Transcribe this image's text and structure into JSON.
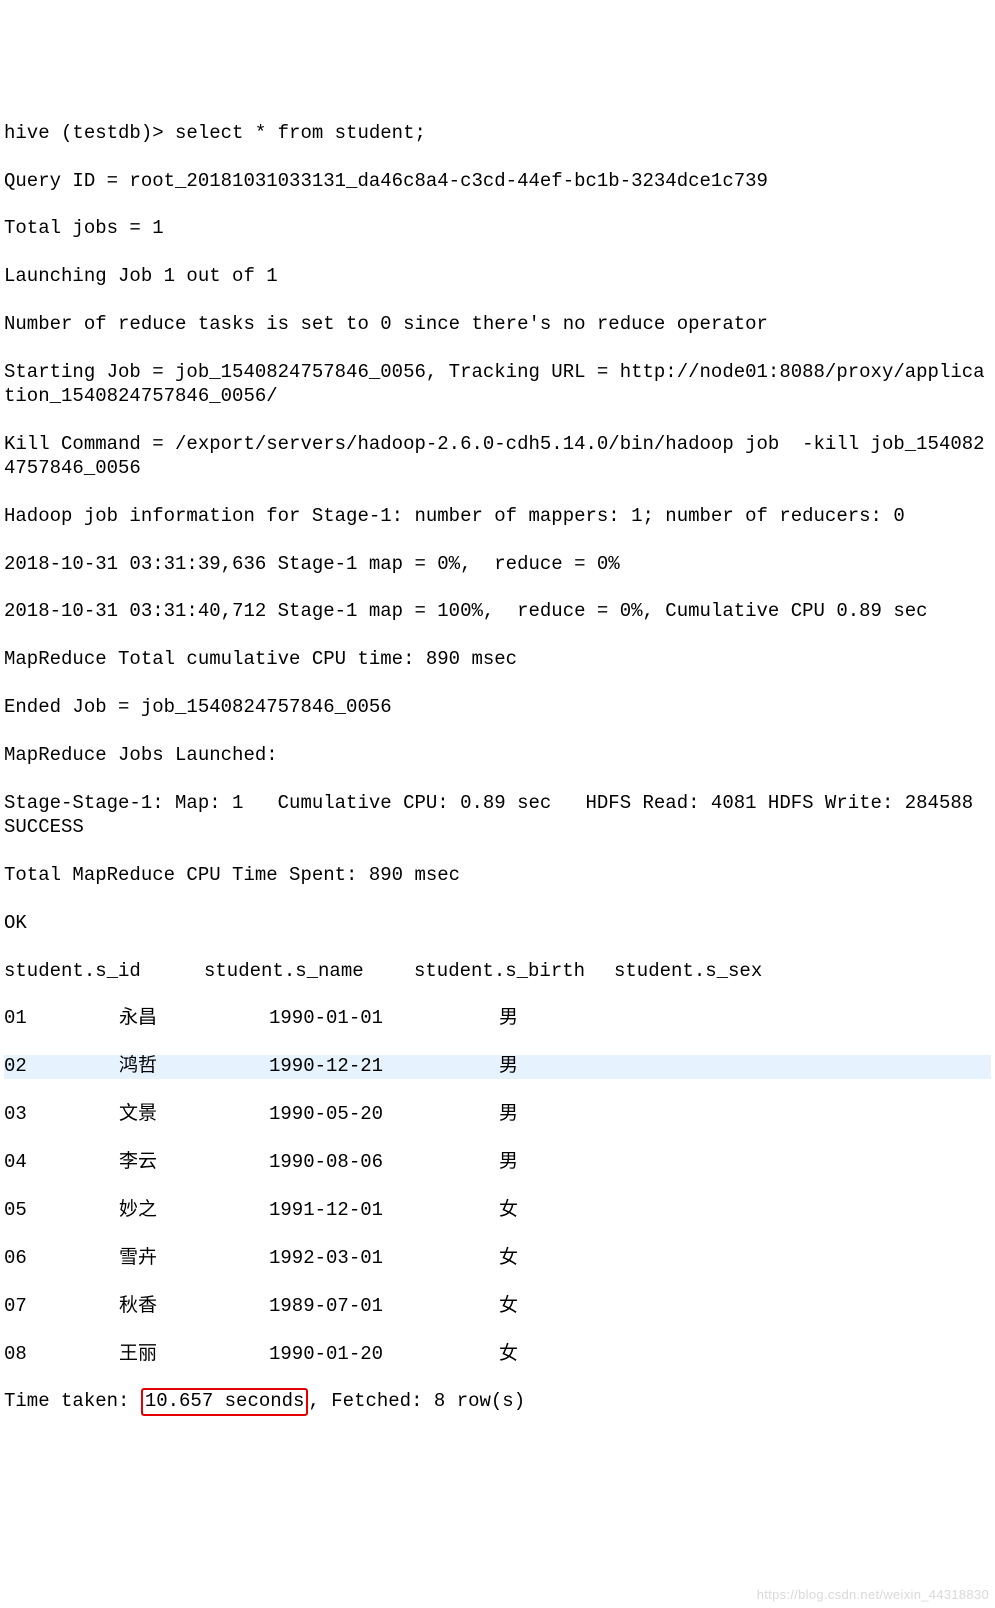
{
  "prompt": "hive (testdb)> ",
  "command": "select * from student;",
  "query_id_line": "Query ID = root_20181031033131_da46c8a4-c3cd-44ef-bc1b-3234dce1c739",
  "total_jobs": "Total jobs = 1",
  "launching": "Launching Job 1 out of 1",
  "reduce_tasks": "Number of reduce tasks is set to 0 since there's no reduce operator",
  "starting_job": "Starting Job = job_1540824757846_0056, Tracking URL = http://node01:8088/proxy/application_1540824757846_0056/",
  "kill_cmd": "Kill Command = /export/servers/hadoop-2.6.0-cdh5.14.0/bin/hadoop job  -kill job_1540824757846_0056",
  "hadoop_info": "Hadoop job information for Stage-1: number of mappers: 1; number of reducers: 0",
  "progress1": "2018-10-31 03:31:39,636 Stage-1 map = 0%,  reduce = 0%",
  "progress2": "2018-10-31 03:31:40,712 Stage-1 map = 100%,  reduce = 0%, Cumulative CPU 0.89 sec",
  "mr_total": "MapReduce Total cumulative CPU time: 890 msec",
  "ended_job": "Ended Job = job_1540824757846_0056",
  "mr_launched": "MapReduce Jobs Launched: ",
  "stage_line": "Stage-Stage-1: Map: 1   Cumulative CPU: 0.89 sec   HDFS Read: 4081 HDFS Write: 284588 SUCCESS",
  "total_cpu": "Total MapReduce CPU Time Spent: 890 msec",
  "ok": "OK",
  "headers": {
    "c1": "student.s_id",
    "c2": "student.s_name",
    "c3": "student.s_birth",
    "c4": "student.s_sex"
  },
  "rows": [
    {
      "id": "01",
      "name": "永昌",
      "birth": "1990-01-01",
      "sex": "男"
    },
    {
      "id": "02",
      "name": "鸿哲",
      "birth": "1990-12-21",
      "sex": "男"
    },
    {
      "id": "03",
      "name": "文景",
      "birth": "1990-05-20",
      "sex": "男"
    },
    {
      "id": "04",
      "name": "李云",
      "birth": "1990-08-06",
      "sex": "男"
    },
    {
      "id": "05",
      "name": "妙之",
      "birth": "1991-12-01",
      "sex": "女"
    },
    {
      "id": "06",
      "name": "雪卉",
      "birth": "1992-03-01",
      "sex": "女"
    },
    {
      "id": "07",
      "name": "秋香",
      "birth": "1989-07-01",
      "sex": "女"
    },
    {
      "id": "08",
      "name": "王丽",
      "birth": "1990-01-20",
      "sex": "女"
    }
  ],
  "time_prefix": "Time taken: ",
  "time_boxed": "10.657 seconds",
  "time_suffix": ", Fetched: 8 row(s)",
  "watermark": "https://blog.csdn.net/weixin_44318830"
}
